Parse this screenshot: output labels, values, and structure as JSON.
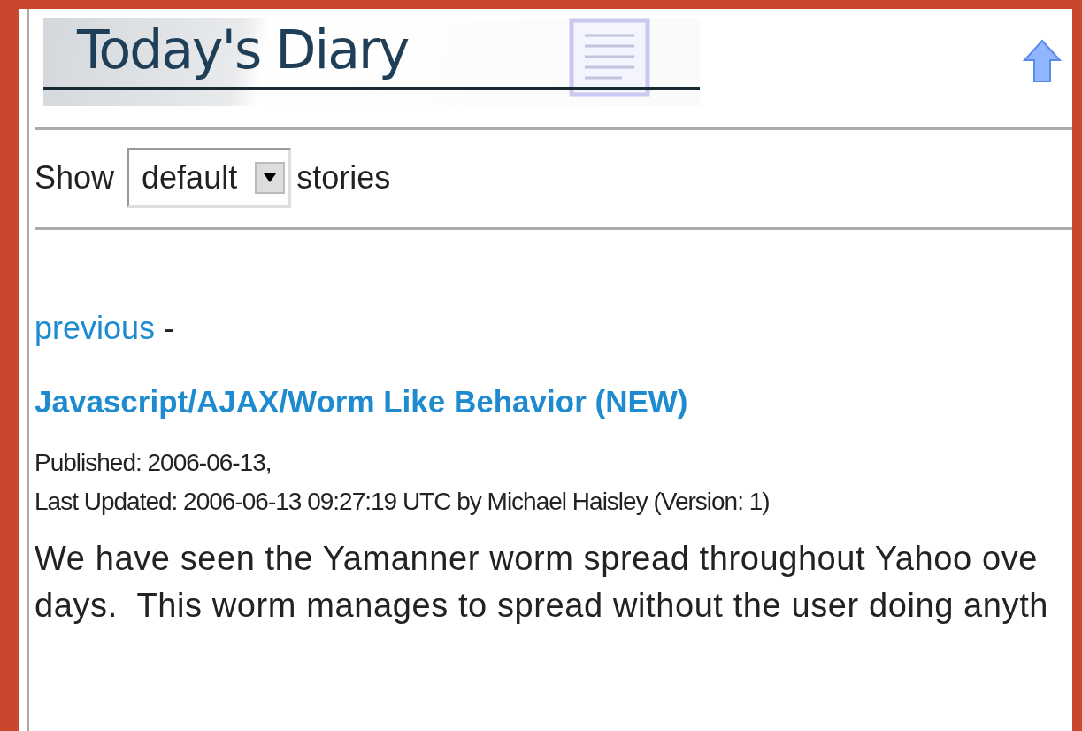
{
  "header": {
    "title": "Today's Diary"
  },
  "filter": {
    "label_before": "Show",
    "select_value": "default",
    "label_after": "stories"
  },
  "nav": {
    "previous": "previous",
    "separator": "-"
  },
  "story": {
    "title": "Javascript/AJAX/Worm Like Behavior (NEW)",
    "published": "Published: 2006-06-13,",
    "updated": "Last Updated: 2006-06-13 09:27:19 UTC by Michael Haisley (Version: 1)",
    "body_lines": [
      "We have seen the Yamanner worm spread throughout Yahoo ove",
      "days.  This worm manages to spread without the user doing anyth"
    ]
  }
}
